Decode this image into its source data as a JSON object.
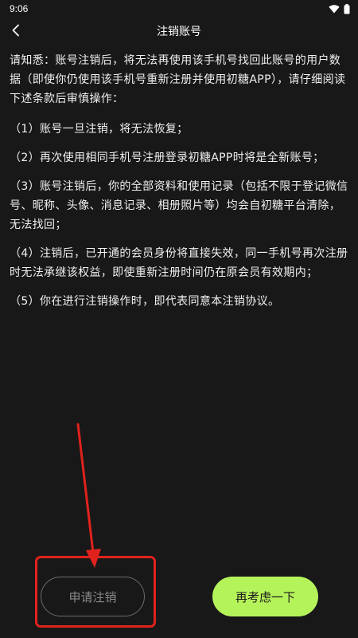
{
  "status_bar": {
    "time": "9:06",
    "icons": [
      "wifi-icon",
      "battery-icon"
    ]
  },
  "header": {
    "title": "注销账号",
    "back_icon": "chevron-left-icon"
  },
  "content": {
    "intro": "请知悉：账号注销后，将无法再使用该手机号找回此账号的用户数据（即使你仍使用该手机号重新注册并使用初糖APP），请仔细阅读下述条款后审慎操作：",
    "terms": [
      "（1）账号一旦注销，将无法恢复；",
      "（2）再次使用相同手机号注册登录初糖APP时将是全新账号；",
      "（3）账号注销后，你的全部资料和使用记录（包括不限于登记微信号、昵称、头像、消息记录、相册照片等）均会自初糖平台清除，无法找回；",
      "（4）注销后，已开通的会员身份将直接失效，同一手机号再次注册时无法承继该权益，即使重新注册时间仍在原会员有效期内；",
      "（5）你在进行注销操作时，即代表同意本注销协议。"
    ]
  },
  "actions": {
    "apply_label": "申请注销",
    "reconsider_label": "再考虑一下"
  },
  "colors": {
    "background": "#181818",
    "accent_green": "#b5f35a",
    "annotation_red": "#e0221c"
  }
}
